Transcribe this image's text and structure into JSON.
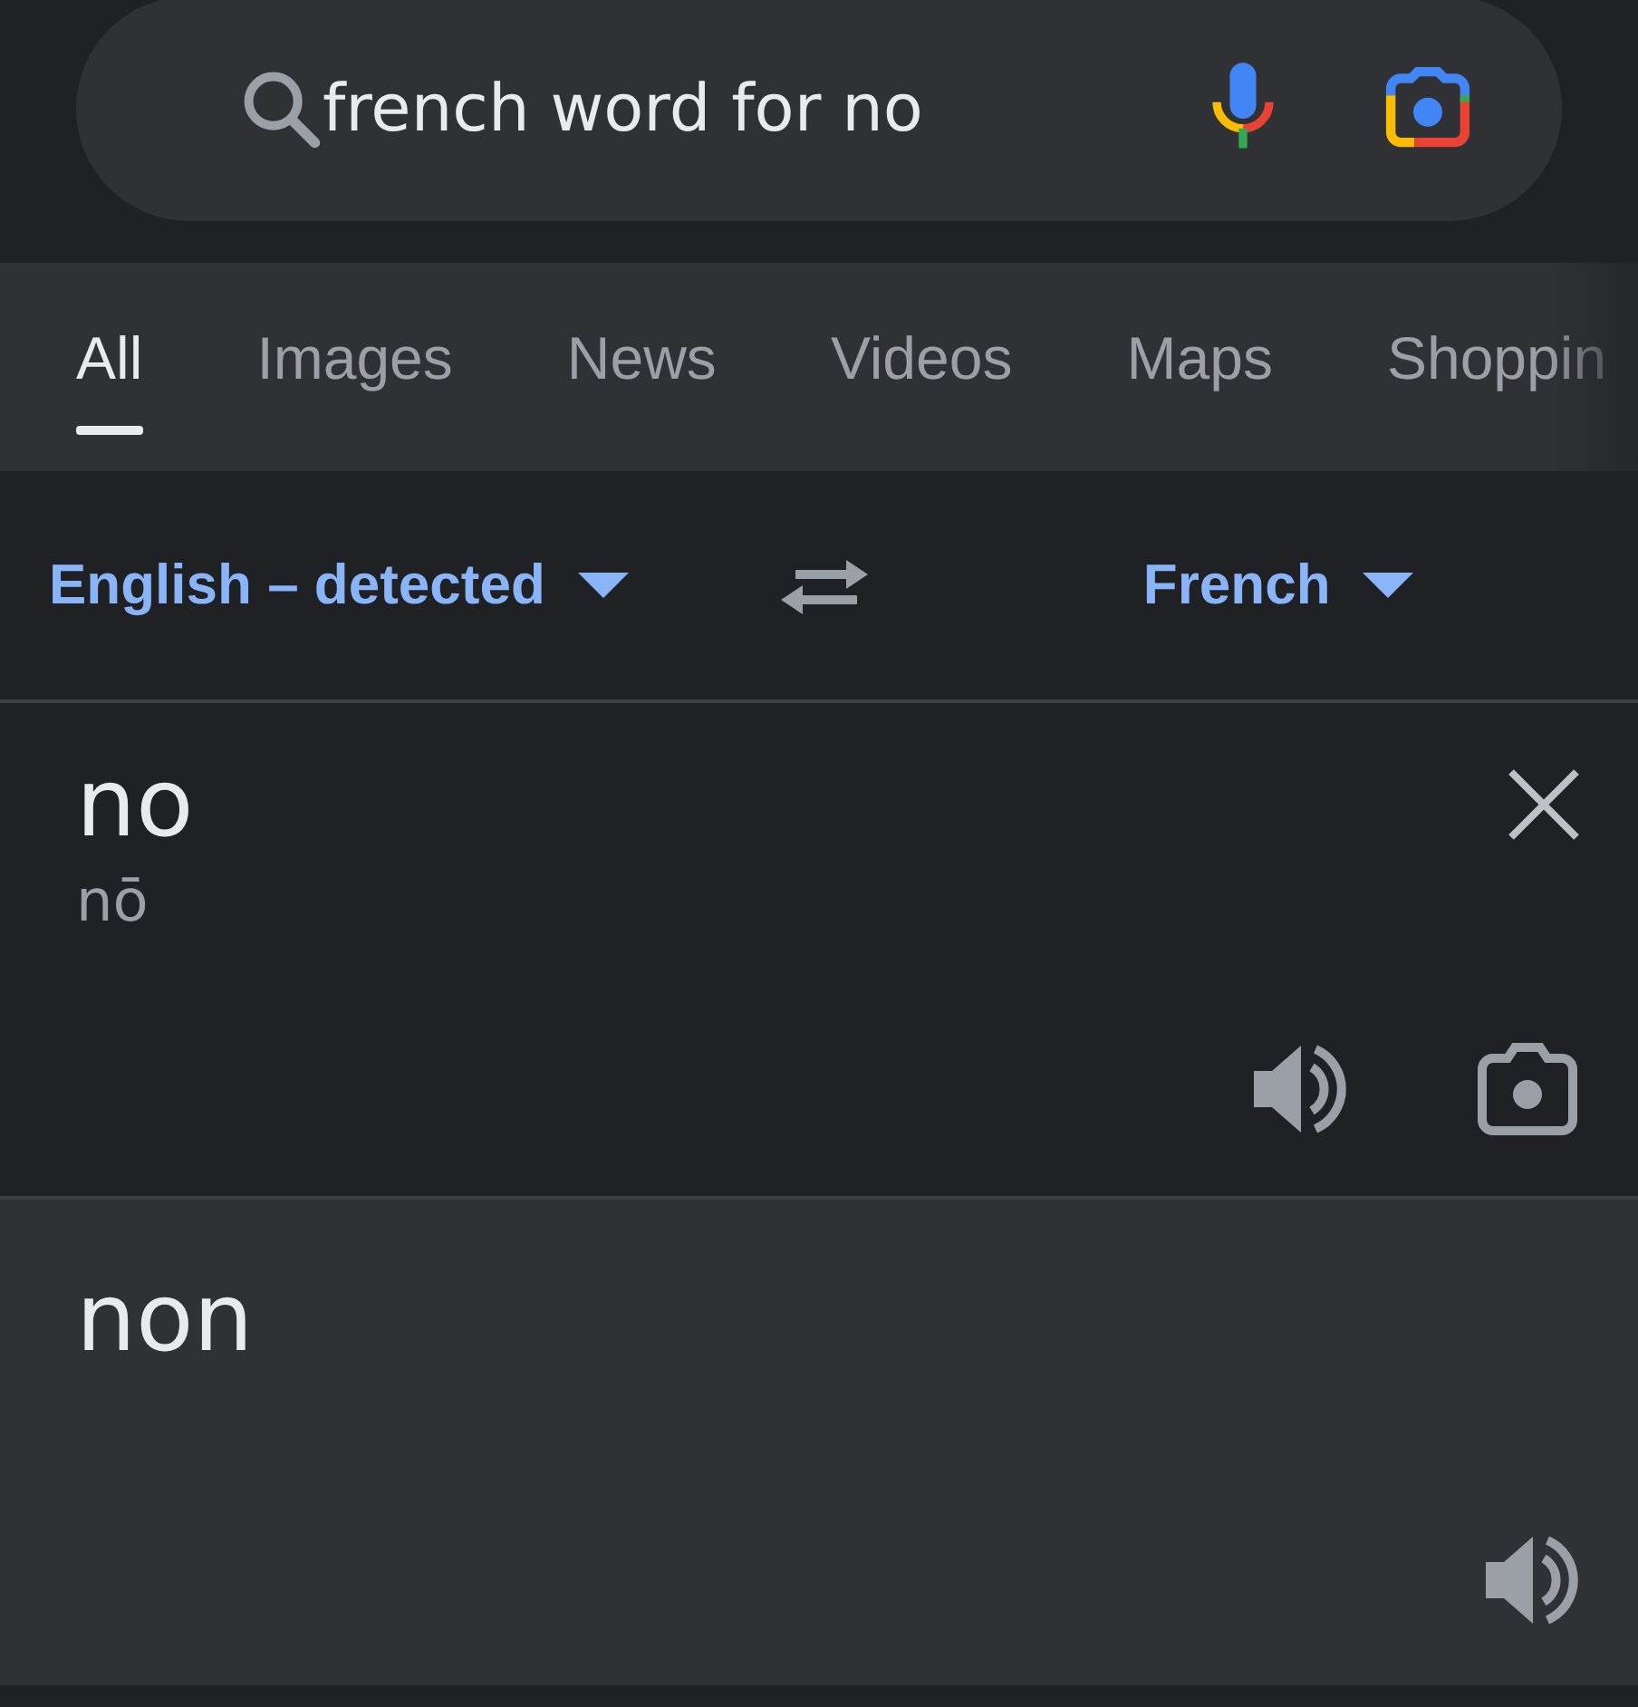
{
  "search": {
    "value": "french word for no"
  },
  "tabs": [
    {
      "label": "All",
      "selected": true
    },
    {
      "label": "Images",
      "selected": false
    },
    {
      "label": "News",
      "selected": false
    },
    {
      "label": "Videos",
      "selected": false
    },
    {
      "label": "Maps",
      "selected": false
    },
    {
      "label": "Shoppin",
      "selected": false
    }
  ],
  "translator": {
    "source_language": "English – detected",
    "target_language": "French",
    "source": {
      "text": "no",
      "pronunciation": "nō"
    },
    "target": {
      "text": "non"
    }
  }
}
